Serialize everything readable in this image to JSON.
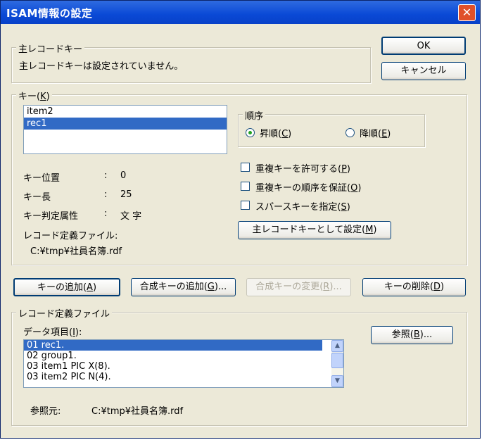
{
  "window": {
    "title": "ISAM情報の設定",
    "close_glyph": "✕"
  },
  "primary_key": {
    "group_label": "主レコードキー",
    "status_text": "主レコードキーは設定されていません。"
  },
  "buttons": {
    "ok": "OK",
    "cancel": "キャンセル",
    "set_primary": "主レコードキーとして設定(M)",
    "add_key": "キーの追加(A)",
    "add_composite": "合成キーの追加(G)...",
    "change_composite": "合成キーの変更(R)...",
    "delete_key": "キーの削除(D)",
    "browse": "参照(B)..."
  },
  "key_group": {
    "label": "キー(K)",
    "items": [
      {
        "text": "item2",
        "selected": false
      },
      {
        "text": "rec1",
        "selected": true
      }
    ],
    "order": {
      "label": "順序",
      "ascending": "昇順(C)",
      "descending": "降順(E)",
      "selected": "ascending"
    },
    "props": [
      {
        "label": "キー位置",
        "sep": ":",
        "value": "0"
      },
      {
        "label": "キー長",
        "sep": ":",
        "value": "25"
      },
      {
        "label": "キー判定属性",
        "sep": ":",
        "value": "文 字"
      }
    ],
    "record_def_label": "レコード定義ファイル:",
    "record_def_path": "C:¥tmp¥社員名簿.rdf",
    "options": [
      {
        "label": "重複キーを許可する(P)",
        "checked": false
      },
      {
        "label": "重複キーの順序を保証(O)",
        "checked": false
      },
      {
        "label": "スパースキーを指定(S)",
        "checked": false
      }
    ]
  },
  "record_def": {
    "group_label": "レコード定義ファイル",
    "data_items_label": "データ項目(I):",
    "items": [
      {
        "text": "01  rec1.",
        "selected": true
      },
      {
        "text": "02    group1.",
        "selected": false
      },
      {
        "text": "03      item1 PIC X(8).",
        "selected": false
      },
      {
        "text": "03      item2 PIC N(4).",
        "selected": false
      }
    ],
    "ref_label": "参照元:",
    "ref_path": "C:¥tmp¥社員名簿.rdf"
  },
  "icons": {
    "scroll_up": "▲",
    "scroll_down": "▼"
  }
}
